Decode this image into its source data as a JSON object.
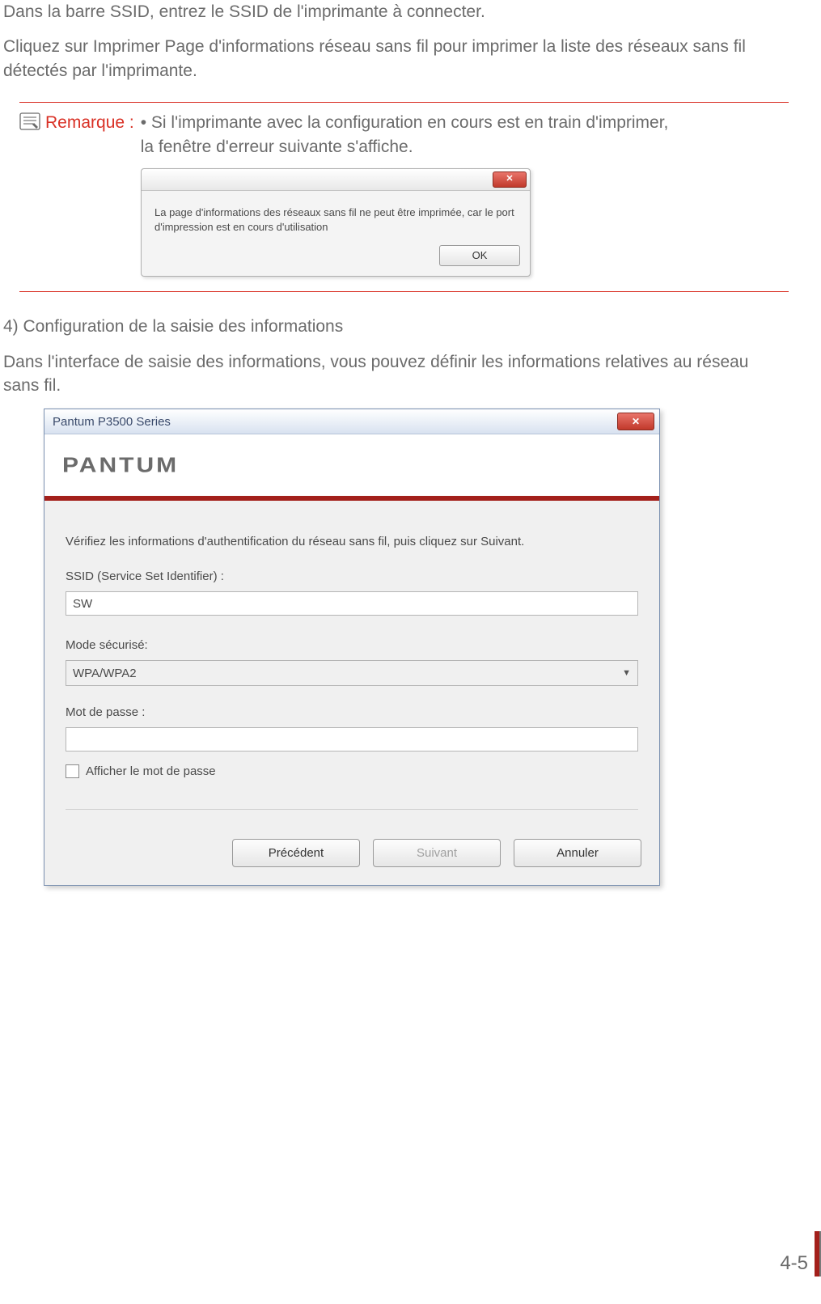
{
  "paragraphs": {
    "p1": "Dans la barre SSID, entrez le SSID de l'imprimante à connecter.",
    "p2": "Cliquez sur Imprimer Page d'informations réseau sans fil pour imprimer la liste des réseaux sans fil détectés par l'imprimante."
  },
  "note": {
    "label": "Remarque :",
    "text_line1": "• Si l'imprimante avec la configuration en cours est en train d'imprimer,",
    "text_line2": "la fenêtre d'erreur suivante s'affiche."
  },
  "error_dialog": {
    "message": "La page d'informations des réseaux sans fil ne peut être imprimée, car le port d'impression est en cours d'utilisation",
    "ok": "OK",
    "close_glyph": "✕"
  },
  "section4": {
    "heading": "4) Configuration de la saisie des informations",
    "text": "Dans l'interface de saisie des informations, vous pouvez définir les informations relatives au réseau sans fil."
  },
  "config_dialog": {
    "title": "Pantum P3500 Series",
    "brand": "PANTUM",
    "instruction": "Vérifiez les informations d'authentification du réseau sans fil, puis cliquez sur Suivant.",
    "ssid_label": "SSID (Service Set Identifier) :",
    "ssid_value": "SW",
    "security_label": "Mode sécurisé:",
    "security_value": "WPA/WPA2",
    "password_label": "Mot de passe :",
    "show_password": "Afficher le mot de passe",
    "btn_prev": "Précédent",
    "btn_next": "Suivant",
    "btn_cancel": "Annuler",
    "close_glyph": "✕"
  },
  "page_number": "4-5"
}
